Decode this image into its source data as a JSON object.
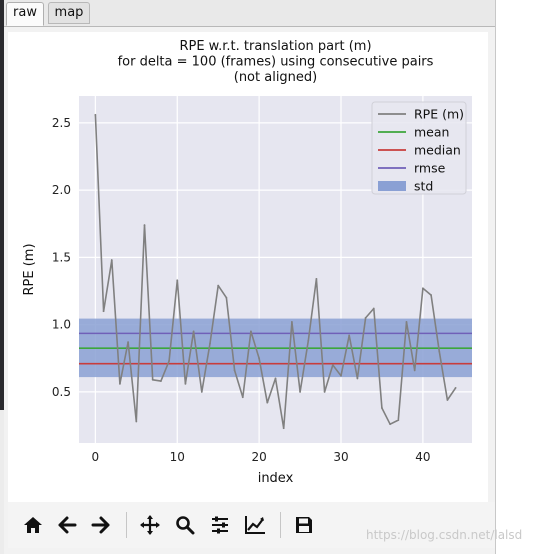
{
  "tabs": [
    {
      "label": "raw",
      "active": true
    },
    {
      "label": "map",
      "active": false
    }
  ],
  "toolbar": {
    "buttons": [
      "home-icon",
      "back-icon",
      "forward-icon",
      "pan-icon",
      "zoom-icon",
      "configure-subplots-icon",
      "edit-axis-icon",
      "save-icon"
    ]
  },
  "watermark": "https://blog.csdn.net/lalsd",
  "chart_data": {
    "type": "line",
    "title": "RPE w.r.t. translation part (m)\nfor delta = 100 (frames) using consecutive pairs\n(not aligned)",
    "xlabel": "index",
    "ylabel": "RPE (m)",
    "xlim": [
      -2,
      46
    ],
    "ylim": [
      0.12,
      2.7
    ],
    "xticks": [
      0,
      10,
      20,
      30,
      40
    ],
    "yticks": [
      0.5,
      1.0,
      1.5,
      2.0,
      2.5
    ],
    "grid": true,
    "legend_position": "top-right",
    "x": [
      0,
      1,
      2,
      3,
      4,
      5,
      6,
      7,
      8,
      9,
      10,
      11,
      12,
      13,
      14,
      15,
      16,
      17,
      18,
      19,
      20,
      21,
      22,
      23,
      24,
      25,
      26,
      27,
      28,
      29,
      30,
      31,
      32,
      33,
      34,
      35,
      36,
      37,
      38,
      39,
      40,
      41,
      42,
      43,
      44
    ],
    "series": [
      {
        "name": "RPE (m)",
        "color": "#808080",
        "values": [
          2.56,
          1.1,
          1.48,
          0.56,
          0.87,
          0.28,
          1.74,
          0.59,
          0.58,
          0.73,
          1.33,
          0.56,
          0.95,
          0.5,
          0.86,
          1.29,
          1.2,
          0.66,
          0.46,
          0.95,
          0.75,
          0.42,
          0.6,
          0.23,
          1.02,
          0.5,
          0.88,
          1.34,
          0.5,
          0.7,
          0.62,
          0.92,
          0.6,
          1.05,
          1.12,
          0.38,
          0.26,
          0.29,
          1.02,
          0.66,
          1.27,
          1.22,
          0.8,
          0.44,
          0.53
        ]
      }
    ],
    "mean": {
      "name": "mean",
      "value": 0.825,
      "color": "#3ca63c"
    },
    "median": {
      "name": "median",
      "value": 0.71,
      "color": "#c83c3c"
    },
    "rmse": {
      "name": "rmse",
      "value": 0.935,
      "color": "#7060b8"
    },
    "std": {
      "name": "std",
      "lower": 0.61,
      "upper": 1.045,
      "color": "#8aa0d4"
    },
    "colors": {
      "axes_bg": "#e6e6f0",
      "grid": "#ffffff"
    }
  }
}
